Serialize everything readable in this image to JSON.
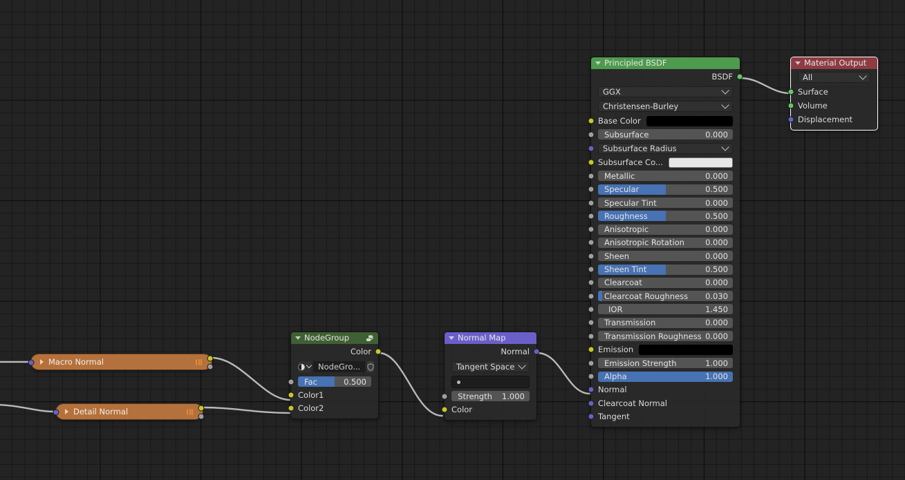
{
  "app": {
    "editor": "shader-node-editor",
    "background_color": "#232323"
  },
  "socket_colors": {
    "color": "#c7c729",
    "value": "#9f9f9f",
    "vector": "#6363c7",
    "shader": "#62c962"
  },
  "nodes": {
    "macro_normal": {
      "title": "Macro Normal",
      "header_color": "#b5713c",
      "collapsed": true
    },
    "detail_normal": {
      "title": "Detail Normal",
      "header_color": "#b5713c",
      "collapsed": true
    },
    "node_group": {
      "title": "NodeGroup",
      "header_color": "#3f6033",
      "outputs": [
        {
          "label": "Color",
          "socket": "color"
        }
      ],
      "datablock": {
        "name": "NodeGro...",
        "icon": "shader-ball-icon"
      },
      "inputs": [
        {
          "label": "Fac",
          "value": "0.500",
          "fill": 0.5,
          "socket": "value",
          "type": "slider"
        },
        {
          "label": "Color1",
          "socket": "color",
          "type": "socket-only"
        },
        {
          "label": "Color2",
          "socket": "color",
          "type": "socket-only"
        }
      ]
    },
    "normal_map": {
      "title": "Normal Map",
      "header_color": "#6a5fc9",
      "outputs": [
        {
          "label": "Normal",
          "socket": "vector"
        }
      ],
      "space": "Tangent Space",
      "uv_map": "",
      "inputs": [
        {
          "label": "Strength",
          "value": "1.000",
          "fill": 0,
          "socket": "value",
          "type": "slider"
        },
        {
          "label": "Color",
          "socket": "color",
          "type": "socket-only"
        }
      ]
    },
    "principled_bsdf": {
      "title": "Principled BSDF",
      "header_color": "#4e9a4e",
      "outputs": [
        {
          "label": "BSDF",
          "socket": "shader"
        }
      ],
      "distribution": "GGX",
      "subsurface_method": "Christensen-Burley",
      "inputs": [
        {
          "label": "Base Color",
          "type": "color",
          "swatch": "#000000",
          "socket": "color"
        },
        {
          "label": "Subsurface",
          "type": "slider",
          "value": "0.000",
          "fill": 0,
          "socket": "value"
        },
        {
          "label": "Subsurface Radius",
          "type": "dropdown",
          "socket": "vector"
        },
        {
          "label": "Subsurface Co...",
          "type": "color",
          "swatch": "#e8e8e8",
          "socket": "color"
        },
        {
          "label": "Metallic",
          "type": "slider",
          "value": "0.000",
          "fill": 0,
          "socket": "value"
        },
        {
          "label": "Specular",
          "type": "slider",
          "value": "0.500",
          "fill": 0.5,
          "socket": "value"
        },
        {
          "label": "Specular Tint",
          "type": "slider",
          "value": "0.000",
          "fill": 0,
          "socket": "value"
        },
        {
          "label": "Roughness",
          "type": "slider",
          "value": "0.500",
          "fill": 0.5,
          "socket": "value"
        },
        {
          "label": "Anisotropic",
          "type": "slider",
          "value": "0.000",
          "fill": 0,
          "socket": "value"
        },
        {
          "label": "Anisotropic Rotation",
          "type": "slider",
          "value": "0.000",
          "fill": 0,
          "socket": "value"
        },
        {
          "label": "Sheen",
          "type": "slider",
          "value": "0.000",
          "fill": 0,
          "socket": "value"
        },
        {
          "label": "Sheen Tint",
          "type": "slider",
          "value": "0.500",
          "fill": 0.5,
          "socket": "value"
        },
        {
          "label": "Clearcoat",
          "type": "slider",
          "value": "0.000",
          "fill": 0,
          "socket": "value"
        },
        {
          "label": "Clearcoat Roughness",
          "type": "slider",
          "value": "0.030",
          "fill": 0.03,
          "socket": "value"
        },
        {
          "label": "IOR",
          "type": "slider",
          "value": "1.450",
          "fill": 0,
          "socket": "value"
        },
        {
          "label": "Transmission",
          "type": "slider",
          "value": "0.000",
          "fill": 0,
          "socket": "value"
        },
        {
          "label": "Transmission Roughness",
          "type": "slider",
          "value": "0.000",
          "fill": 0,
          "socket": "value"
        },
        {
          "label": "Emission",
          "type": "color",
          "swatch": "#000000",
          "socket": "color"
        },
        {
          "label": "Emission Strength",
          "type": "slider",
          "value": "1.000",
          "fill": 0,
          "socket": "value"
        },
        {
          "label": "Alpha",
          "type": "slider",
          "value": "1.000",
          "fill": 1,
          "socket": "value"
        },
        {
          "label": "Normal",
          "type": "socket-only",
          "socket": "vector"
        },
        {
          "label": "Clearcoat Normal",
          "type": "socket-only",
          "socket": "vector"
        },
        {
          "label": "Tangent",
          "type": "socket-only",
          "socket": "vector"
        }
      ]
    },
    "material_output": {
      "title": "Material Output",
      "header_color": "#8e3b42",
      "selected": true,
      "target": "All",
      "inputs": [
        {
          "label": "Surface",
          "socket": "shader"
        },
        {
          "label": "Volume",
          "socket": "shader"
        },
        {
          "label": "Displacement",
          "socket": "vector"
        }
      ]
    }
  }
}
